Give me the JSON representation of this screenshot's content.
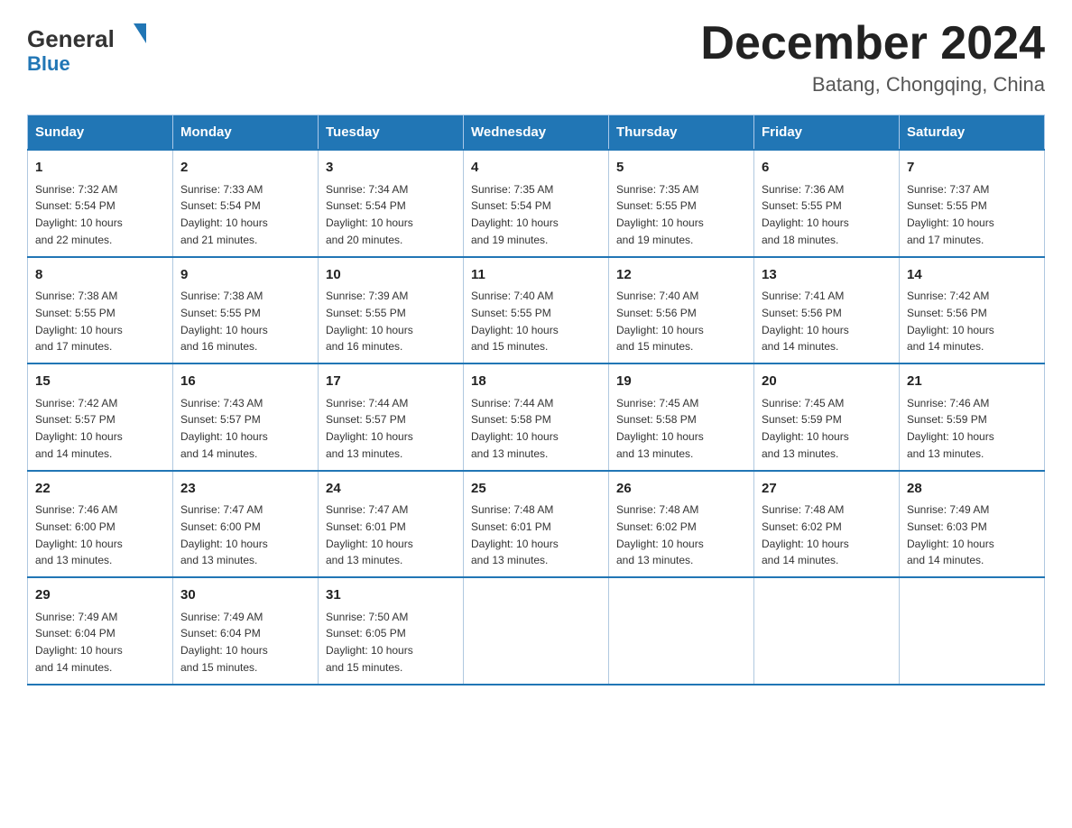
{
  "header": {
    "logo": {
      "general": "General",
      "blue": "Blue",
      "triangle_color": "#1a7abf"
    },
    "title": "December 2024",
    "subtitle": "Batang, Chongqing, China"
  },
  "calendar": {
    "days_of_week": [
      "Sunday",
      "Monday",
      "Tuesday",
      "Wednesday",
      "Thursday",
      "Friday",
      "Saturday"
    ],
    "weeks": [
      [
        {
          "day": "1",
          "sunrise": "7:32 AM",
          "sunset": "5:54 PM",
          "daylight": "10 hours and 22 minutes."
        },
        {
          "day": "2",
          "sunrise": "7:33 AM",
          "sunset": "5:54 PM",
          "daylight": "10 hours and 21 minutes."
        },
        {
          "day": "3",
          "sunrise": "7:34 AM",
          "sunset": "5:54 PM",
          "daylight": "10 hours and 20 minutes."
        },
        {
          "day": "4",
          "sunrise": "7:35 AM",
          "sunset": "5:54 PM",
          "daylight": "10 hours and 19 minutes."
        },
        {
          "day": "5",
          "sunrise": "7:35 AM",
          "sunset": "5:55 PM",
          "daylight": "10 hours and 19 minutes."
        },
        {
          "day": "6",
          "sunrise": "7:36 AM",
          "sunset": "5:55 PM",
          "daylight": "10 hours and 18 minutes."
        },
        {
          "day": "7",
          "sunrise": "7:37 AM",
          "sunset": "5:55 PM",
          "daylight": "10 hours and 17 minutes."
        }
      ],
      [
        {
          "day": "8",
          "sunrise": "7:38 AM",
          "sunset": "5:55 PM",
          "daylight": "10 hours and 17 minutes."
        },
        {
          "day": "9",
          "sunrise": "7:38 AM",
          "sunset": "5:55 PM",
          "daylight": "10 hours and 16 minutes."
        },
        {
          "day": "10",
          "sunrise": "7:39 AM",
          "sunset": "5:55 PM",
          "daylight": "10 hours and 16 minutes."
        },
        {
          "day": "11",
          "sunrise": "7:40 AM",
          "sunset": "5:55 PM",
          "daylight": "10 hours and 15 minutes."
        },
        {
          "day": "12",
          "sunrise": "7:40 AM",
          "sunset": "5:56 PM",
          "daylight": "10 hours and 15 minutes."
        },
        {
          "day": "13",
          "sunrise": "7:41 AM",
          "sunset": "5:56 PM",
          "daylight": "10 hours and 14 minutes."
        },
        {
          "day": "14",
          "sunrise": "7:42 AM",
          "sunset": "5:56 PM",
          "daylight": "10 hours and 14 minutes."
        }
      ],
      [
        {
          "day": "15",
          "sunrise": "7:42 AM",
          "sunset": "5:57 PM",
          "daylight": "10 hours and 14 minutes."
        },
        {
          "day": "16",
          "sunrise": "7:43 AM",
          "sunset": "5:57 PM",
          "daylight": "10 hours and 14 minutes."
        },
        {
          "day": "17",
          "sunrise": "7:44 AM",
          "sunset": "5:57 PM",
          "daylight": "10 hours and 13 minutes."
        },
        {
          "day": "18",
          "sunrise": "7:44 AM",
          "sunset": "5:58 PM",
          "daylight": "10 hours and 13 minutes."
        },
        {
          "day": "19",
          "sunrise": "7:45 AM",
          "sunset": "5:58 PM",
          "daylight": "10 hours and 13 minutes."
        },
        {
          "day": "20",
          "sunrise": "7:45 AM",
          "sunset": "5:59 PM",
          "daylight": "10 hours and 13 minutes."
        },
        {
          "day": "21",
          "sunrise": "7:46 AM",
          "sunset": "5:59 PM",
          "daylight": "10 hours and 13 minutes."
        }
      ],
      [
        {
          "day": "22",
          "sunrise": "7:46 AM",
          "sunset": "6:00 PM",
          "daylight": "10 hours and 13 minutes."
        },
        {
          "day": "23",
          "sunrise": "7:47 AM",
          "sunset": "6:00 PM",
          "daylight": "10 hours and 13 minutes."
        },
        {
          "day": "24",
          "sunrise": "7:47 AM",
          "sunset": "6:01 PM",
          "daylight": "10 hours and 13 minutes."
        },
        {
          "day": "25",
          "sunrise": "7:48 AM",
          "sunset": "6:01 PM",
          "daylight": "10 hours and 13 minutes."
        },
        {
          "day": "26",
          "sunrise": "7:48 AM",
          "sunset": "6:02 PM",
          "daylight": "10 hours and 13 minutes."
        },
        {
          "day": "27",
          "sunrise": "7:48 AM",
          "sunset": "6:02 PM",
          "daylight": "10 hours and 14 minutes."
        },
        {
          "day": "28",
          "sunrise": "7:49 AM",
          "sunset": "6:03 PM",
          "daylight": "10 hours and 14 minutes."
        }
      ],
      [
        {
          "day": "29",
          "sunrise": "7:49 AM",
          "sunset": "6:04 PM",
          "daylight": "10 hours and 14 minutes."
        },
        {
          "day": "30",
          "sunrise": "7:49 AM",
          "sunset": "6:04 PM",
          "daylight": "10 hours and 15 minutes."
        },
        {
          "day": "31",
          "sunrise": "7:50 AM",
          "sunset": "6:05 PM",
          "daylight": "10 hours and 15 minutes."
        },
        null,
        null,
        null,
        null
      ]
    ],
    "labels": {
      "sunrise": "Sunrise:",
      "sunset": "Sunset:",
      "daylight": "Daylight:"
    }
  }
}
